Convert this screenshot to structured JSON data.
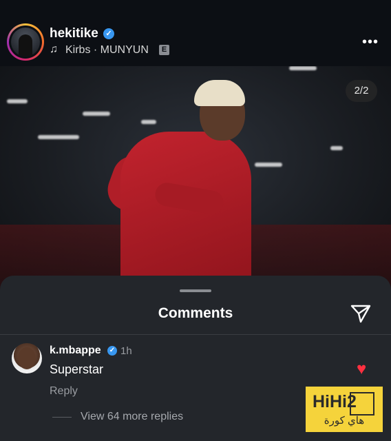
{
  "post": {
    "username": "hekitike",
    "verified": true,
    "music_icon": "music-note-icon",
    "music": "Kirbs · MUNYUN",
    "explicit_badge": "E",
    "more_icon": "more-options-icon",
    "more_glyph": "•••",
    "image_counter": "2/2"
  },
  "comments_sheet": {
    "title": "Comments",
    "send_icon": "send-icon"
  },
  "comments": [
    {
      "username": "k.mbappe",
      "verified": true,
      "time": "1h",
      "text": "Superstar",
      "reply_label": "Reply",
      "liked": true,
      "heart_icon": "heart-filled-icon",
      "view_replies": "View 64 more replies"
    }
  ],
  "watermark": {
    "text_latin": "HiHi2",
    "text_arabic": "هاي كورة"
  },
  "colors": {
    "verified_blue": "#3897f0",
    "like_red": "#ff3040",
    "watermark_yellow": "#f5d33b"
  }
}
